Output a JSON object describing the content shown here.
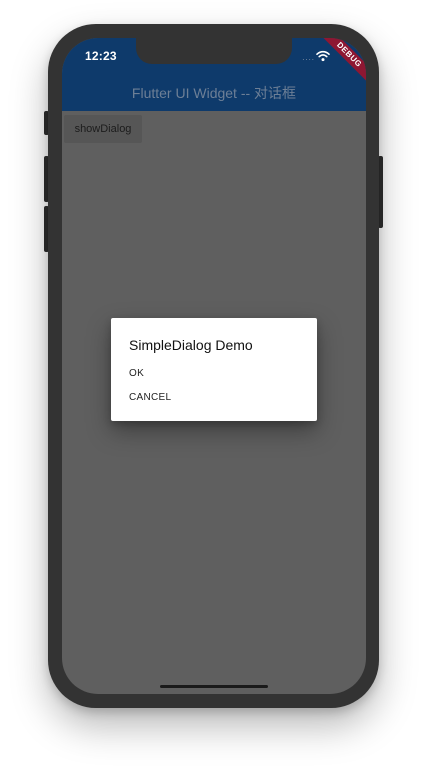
{
  "status_bar": {
    "time": "12:23",
    "signal": "····",
    "debug_banner": "DEBUG"
  },
  "app_bar": {
    "title": "Flutter UI Widget -- 对话框"
  },
  "body": {
    "show_dialog_label": "showDialog"
  },
  "dialog": {
    "title": "SimpleDialog Demo",
    "options": [
      "OK",
      "CANCEL"
    ]
  },
  "icons": {
    "wifi": "wifi-icon"
  },
  "colors": {
    "app_bar": "#0e3a6b",
    "scrim": "#5f5f5f",
    "debug_ribbon": "#8e1732",
    "dialog_bg": "#ffffff"
  }
}
